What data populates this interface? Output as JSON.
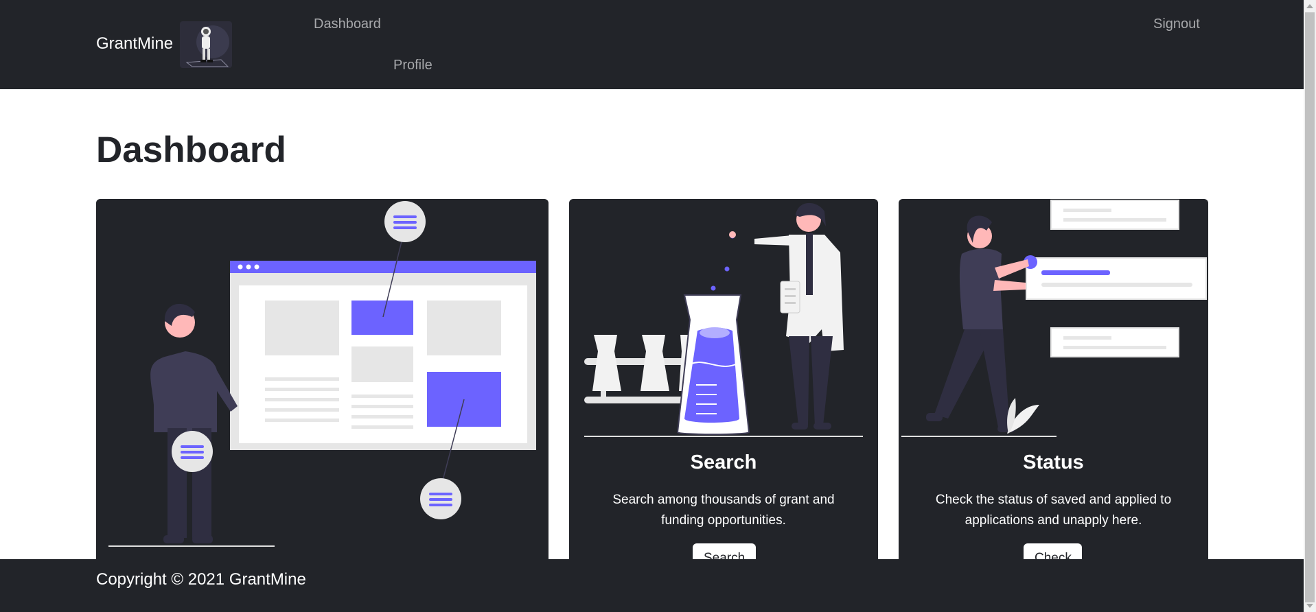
{
  "nav": {
    "brand": "GrantMine",
    "logo_icon": "astronaut-logo-icon",
    "links": [
      {
        "label": "Dashboard"
      },
      {
        "label": "Profile"
      },
      {
        "label": "Signout"
      }
    ]
  },
  "page": {
    "title": "Dashboard"
  },
  "cards": [
    {
      "illustration_icon": "dashboard-illustration-icon"
    },
    {
      "illustration_icon": "scientist-beaker-illustration-icon",
      "title": "Search",
      "text": "Search among thousands of grant and funding opportunities.",
      "button_label": "Search"
    },
    {
      "illustration_icon": "person-status-cards-illustration-icon",
      "title": "Status",
      "text": "Check the status of saved and applied to applications and unapply here.",
      "button_label": "Check"
    }
  ],
  "footer": {
    "copyright": "Copyright © 2021 GrantMine"
  },
  "colors": {
    "nav_bg": "#222429",
    "card_bg": "#222429",
    "accent": "#6c63ff",
    "text_light": "#ffffff",
    "nav_link": "#a7a8ab"
  }
}
